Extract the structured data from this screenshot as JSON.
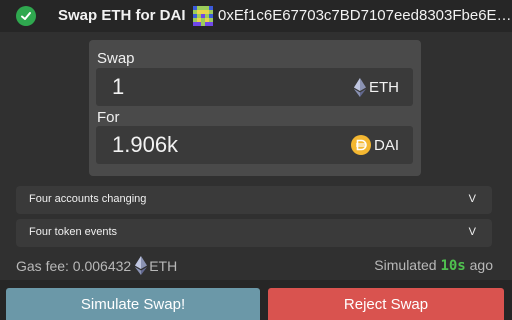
{
  "header": {
    "title": "Swap ETH for DAI",
    "address": "0xEf1c6E67703c7BD7107eed8303Fbe6E…"
  },
  "swap": {
    "swap_label": "Swap",
    "swap_amount": "1",
    "swap_token": "ETH",
    "for_label": "For",
    "for_amount": "1.906k",
    "for_token": "DAI"
  },
  "sections": {
    "accounts": {
      "label": "Four accounts changing",
      "chevron": "V"
    },
    "tokens": {
      "label": "Four token events",
      "chevron": "V"
    }
  },
  "gas": {
    "label": "Gas fee: 0.006432",
    "token": "ETH"
  },
  "simulated": {
    "prefix": "Simulated",
    "seconds": "10s",
    "suffix": "ago"
  },
  "buttons": {
    "simulate": "Simulate Swap!",
    "reject": "Reject Swap"
  },
  "colors": {
    "success": "#2fa84f",
    "simulate_button": "#6b98a8",
    "reject_button": "#d9534f",
    "dai": "#f4b731",
    "seconds_highlight": "#4fc14f"
  },
  "icons": {
    "status": "check-icon",
    "address": "identicon",
    "eth": "eth-icon",
    "dai": "dai-icon"
  }
}
